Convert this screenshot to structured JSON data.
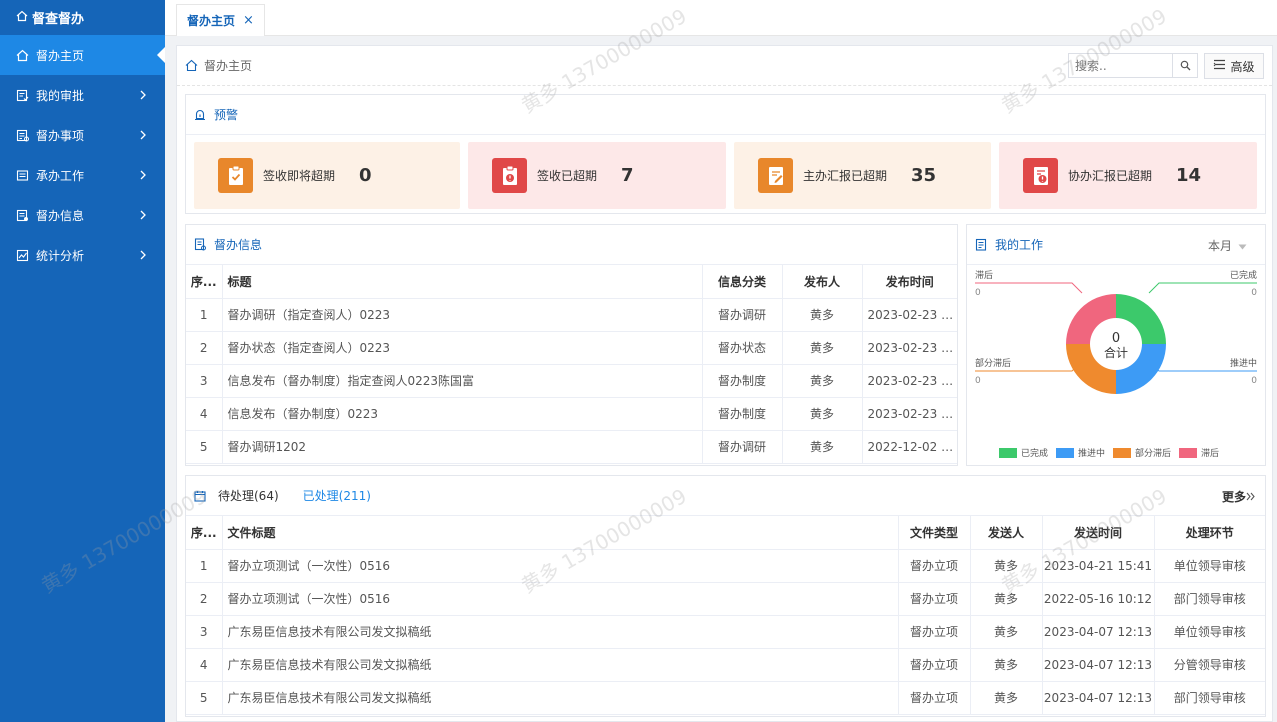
{
  "app": {
    "brand": "督查督办"
  },
  "sidebar": {
    "items": [
      {
        "label": "督办主页",
        "icon": "home-icon"
      },
      {
        "label": "我的审批",
        "icon": "approval-icon"
      },
      {
        "label": "督办事项",
        "icon": "tasks-icon"
      },
      {
        "label": "承办工作",
        "icon": "work-icon"
      },
      {
        "label": "督办信息",
        "icon": "info-icon"
      },
      {
        "label": "统计分析",
        "icon": "chart-icon"
      }
    ]
  },
  "tabbar": {
    "tab_label": "督办主页",
    "close": "×"
  },
  "breadcrumb": {
    "label": "督办主页"
  },
  "search": {
    "placeholder": "搜索..",
    "advanced_label": "高级"
  },
  "warning": {
    "title": "预警",
    "cards": [
      {
        "label": "签收即将超期",
        "value": "0",
        "bg": "#fdf1e6",
        "icon_bg": "#e8872b",
        "icon": "clipboard-check-icon"
      },
      {
        "label": "签收已超期",
        "value": "7",
        "bg": "#fde8e8",
        "icon_bg": "#e04848",
        "icon": "clipboard-alert-icon"
      },
      {
        "label": "主办汇报已超期",
        "value": "35",
        "bg": "#fdf1e6",
        "icon_bg": "#e8872b",
        "icon": "report-edit-icon"
      },
      {
        "label": "协办汇报已超期",
        "value": "14",
        "bg": "#fde8e8",
        "icon_bg": "#e04848",
        "icon": "report-alert-icon"
      }
    ]
  },
  "info": {
    "title": "督办信息",
    "columns": [
      "序...",
      "标题",
      "信息分类",
      "发布人",
      "发布时间"
    ],
    "rows": [
      {
        "no": "1",
        "title": "督办调研（指定查阅人）0223",
        "category": "督办调研",
        "publisher": "黄多",
        "time": "2023-02-23 1..."
      },
      {
        "no": "2",
        "title": "督办状态（指定查阅人）0223",
        "category": "督办状态",
        "publisher": "黄多",
        "time": "2023-02-23 1..."
      },
      {
        "no": "3",
        "title": "信息发布（督办制度）指定查阅人0223陈国富",
        "category": "督办制度",
        "publisher": "黄多",
        "time": "2023-02-23 1..."
      },
      {
        "no": "4",
        "title": "信息发布（督办制度）0223",
        "category": "督办制度",
        "publisher": "黄多",
        "time": "2023-02-23 1..."
      },
      {
        "no": "5",
        "title": "督办调研1202",
        "category": "督办调研",
        "publisher": "黄多",
        "time": "2022-12-02 2..."
      }
    ]
  },
  "mywork": {
    "title": "我的工作",
    "period": "本月",
    "center_value": "0",
    "center_label": "合计",
    "labels": {
      "lagging": "滞后",
      "lagging_v": "0",
      "done": "已完成",
      "done_v": "0",
      "partial": "部分滞后",
      "partial_v": "0",
      "progress": "推进中",
      "progress_v": "0"
    },
    "legend": [
      {
        "name": "已完成",
        "color": "#3cc96b"
      },
      {
        "name": "推进中",
        "color": "#3d9bf5"
      },
      {
        "name": "部分滞后",
        "color": "#ef8a2e"
      },
      {
        "name": "滞后",
        "color": "#f0667e"
      }
    ]
  },
  "pending": {
    "tab_pending": "待处理(64)",
    "tab_done": "已处理(211)",
    "more": "更多",
    "columns": [
      "序...",
      "文件标题",
      "文件类型",
      "发送人",
      "发送时间",
      "处理环节"
    ],
    "rows": [
      {
        "no": "1",
        "title": "督办立项测试（一次性）0516",
        "type": "督办立项",
        "sender": "黄多",
        "time": "2023-04-21 15:41",
        "step": "单位领导审核"
      },
      {
        "no": "2",
        "title": "督办立项测试（一次性）0516",
        "type": "督办立项",
        "sender": "黄多",
        "time": "2022-05-16 10:12",
        "step": "部门领导审核"
      },
      {
        "no": "3",
        "title": "广东易臣信息技术有限公司发文拟稿纸",
        "type": "督办立项",
        "sender": "黄多",
        "time": "2023-04-07 12:13",
        "step": "单位领导审核"
      },
      {
        "no": "4",
        "title": "广东易臣信息技术有限公司发文拟稿纸",
        "type": "督办立项",
        "sender": "黄多",
        "time": "2023-04-07 12:13",
        "step": "分管领导审核"
      },
      {
        "no": "5",
        "title": "广东易臣信息技术有限公司发文拟稿纸",
        "type": "督办立项",
        "sender": "黄多",
        "time": "2023-04-07 12:13",
        "step": "部门领导审核"
      }
    ]
  },
  "watermark": "黄多 13700000009"
}
